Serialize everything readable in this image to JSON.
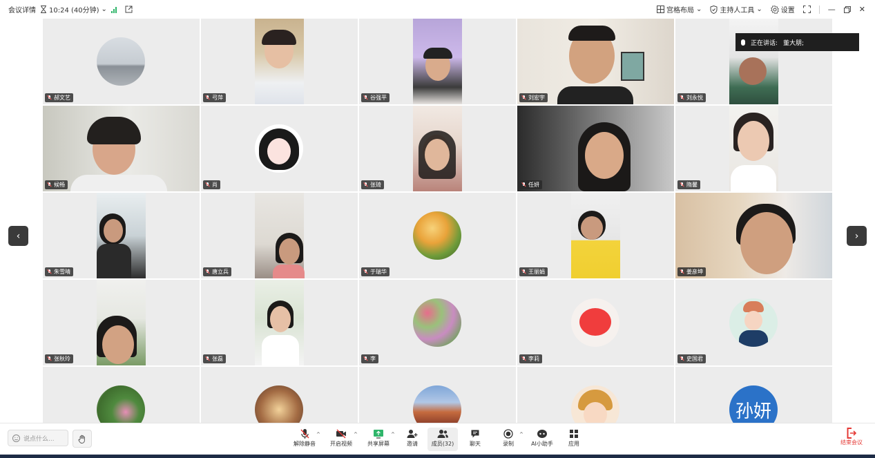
{
  "topbar": {
    "meeting_details": "会议详情",
    "duration": "10:24 (40分钟)",
    "layout": "宫格布局",
    "host_tools": "主持人工具",
    "settings": "设置"
  },
  "speaking": {
    "label": "正在讲话:",
    "name": "董大朋;"
  },
  "participants": [
    {
      "name": "郝文艺"
    },
    {
      "name": "弓萍"
    },
    {
      "name": "谷强平"
    },
    {
      "name": "刘宏宇"
    },
    {
      "name": "刘永悦"
    },
    {
      "name": "候畅"
    },
    {
      "name": "肖"
    },
    {
      "name": "张琦"
    },
    {
      "name": "任妍"
    },
    {
      "name": "隋馨"
    },
    {
      "name": "朱雪晴"
    },
    {
      "name": "唐立兵"
    },
    {
      "name": "于瑞华"
    },
    {
      "name": "王丽娟"
    },
    {
      "name": "姜彦坤"
    },
    {
      "name": "张秋玲"
    },
    {
      "name": "张磊"
    },
    {
      "name": "李"
    },
    {
      "name": "李莉"
    },
    {
      "name": "史国君"
    }
  ],
  "text_avatar": "孙妍",
  "bottombar": {
    "chat_placeholder": "说点什么...",
    "unmute": "解除静音",
    "start_video": "开启视频",
    "share_screen": "共享屏幕",
    "invite": "邀请",
    "members": "成员(32)",
    "chat": "聊天",
    "record": "录制",
    "ai_assistant": "AI小助手",
    "apps": "应用",
    "end_meeting": "结束会议"
  },
  "colors": {
    "accent_green": "#2fb56a",
    "end_red": "#e53935",
    "tile_bg": "#ececec",
    "text_avatar_bg": "#2b72c8"
  }
}
